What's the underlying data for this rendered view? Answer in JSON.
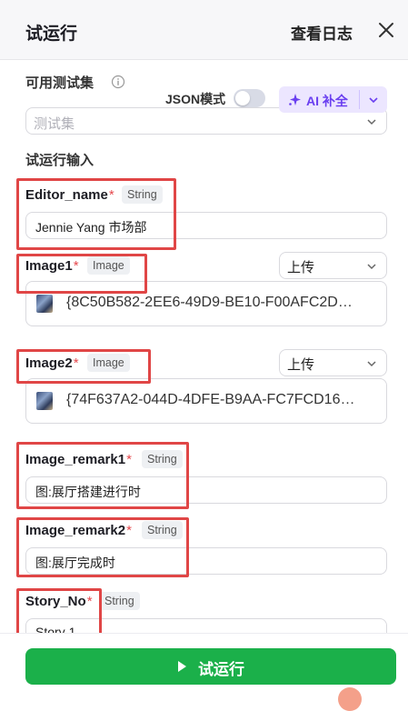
{
  "header": {
    "title": "试运行",
    "log_label": "查看日志",
    "close_icon": "close-icon"
  },
  "test_set": {
    "label": "可用测试集",
    "info_icon": "info-icon",
    "placeholder": "测试集"
  },
  "run_input": {
    "label": "试运行输入",
    "json_mode_label": "JSON模式",
    "json_mode_on": false,
    "ai_button_label": "AI 补全",
    "accent_color": "#6a3ff0"
  },
  "fields": {
    "editor_name": {
      "name": "Editor_name",
      "required": "*",
      "type": "String",
      "value": "Jennie Yang 市场部"
    },
    "image1": {
      "name": "Image1",
      "required": "*",
      "type": "Image",
      "mode": "上传",
      "file": "{8C50B582-2EE6-49D9-BE10-F00AFC2D…"
    },
    "image2": {
      "name": "Image2",
      "required": "*",
      "type": "Image",
      "mode": "上传",
      "file": "{74F637A2-044D-4DFE-B9AA-FC7FCD16…"
    },
    "image_remark1": {
      "name": "Image_remark1",
      "required": "*",
      "type": "String",
      "value": "图:展厅搭建进行时"
    },
    "image_remark2": {
      "name": "Image_remark2",
      "required": "*",
      "type": "String",
      "value": "图:展厅完成时"
    },
    "story_no": {
      "name": "Story_No",
      "required": "*",
      "type": "String",
      "value": "Story 1"
    }
  },
  "footer": {
    "run_label": "试运行",
    "button_color": "#1bb04a"
  },
  "annotation_color": "#e04646"
}
